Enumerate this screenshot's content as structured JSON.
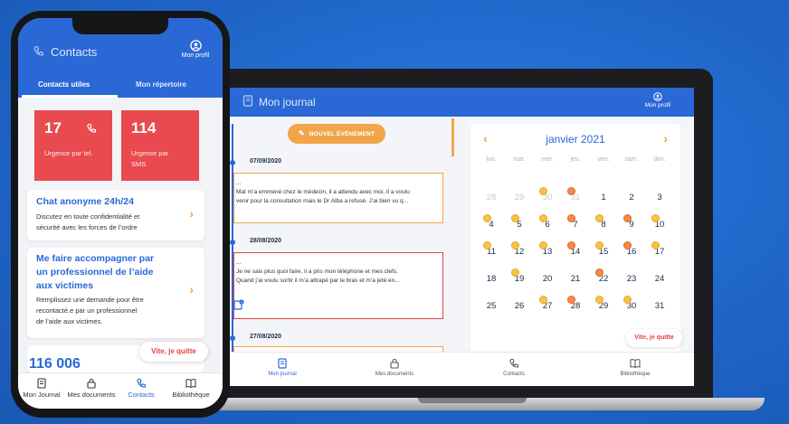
{
  "phone": {
    "header": {
      "title": "Contacts",
      "profile_label": "Mon profil"
    },
    "tabs": [
      {
        "label": "Contacts utiles",
        "active": true
      },
      {
        "label": "Mon répertoire",
        "active": false
      }
    ],
    "urgency_cards": [
      {
        "number": "17",
        "label": "Urgence par tel.",
        "icon": "phone-icon"
      },
      {
        "number": "114",
        "label_line1": "Urgence par",
        "label_line2": "SMS"
      }
    ],
    "cards": [
      {
        "title": "Chat anonyme 24h/24",
        "text_line1": "Discutez en toute confidentialité et",
        "text_line2": "sécurité avec les forces de l’ordre"
      },
      {
        "title_line1": "Me faire accompagner par",
        "title_line2": "un professionnel de l’aide",
        "title_line3": "aux victimes",
        "text_line1": "Remplissez une demande pour être",
        "text_line2": "recontacté.e par un professionnel",
        "text_line3": "de l’aide aux victimes."
      }
    ],
    "partial_number": "116 006",
    "quit_button": "Vite, je quitte",
    "nav": [
      {
        "label": "Mon Journal",
        "icon": "journal-icon",
        "active": false
      },
      {
        "label": "Mes documents",
        "icon": "lock-icon",
        "active": false
      },
      {
        "label": "Contacts",
        "icon": "phone-icon",
        "active": true
      },
      {
        "label": "Bibliothèque",
        "icon": "book-icon",
        "active": false
      }
    ]
  },
  "laptop": {
    "header": {
      "title": "Mon journal",
      "profile_label": "Mon profil"
    },
    "new_event_button": "NOUVEL ÉVÉNEMENT",
    "entries": [
      {
        "date": "07/09/2020",
        "line0": "...",
        "line1": "Mat m’a emmené chez le médecin, il a attendu avec moi. Il a voulu",
        "line2": "venir pour la consultation mais le Dr Alba a refusé. J’ai bien vu q...",
        "border": "orange"
      },
      {
        "date": "28/08/2020",
        "line0": "...",
        "line1": "Je ne sais plus quoi faire, il a pris mon téléphone et mes clefs.",
        "line2": "Quand j’ai voulu sortir il m’a attrapé par le bras et m’a jeté en...",
        "border": "red",
        "attachment_count": "1"
      },
      {
        "date": "27/08/2020"
      }
    ],
    "calendar": {
      "month": "janvier 2021",
      "weekdays": [
        "lun.",
        "mar.",
        "mer.",
        "jeu.",
        "ven.",
        "sam.",
        "dim."
      ],
      "weeks": [
        [
          "28",
          "29",
          "30",
          "31",
          "1",
          "2",
          "3"
        ],
        [
          "4",
          "5",
          "6",
          "7",
          "8",
          "9",
          "10"
        ],
        [
          "11",
          "12",
          "13",
          "14",
          "15",
          "16",
          "17"
        ],
        [
          "18",
          "19",
          "20",
          "21",
          "22",
          "23",
          "24"
        ],
        [
          "25",
          "26",
          "27",
          "28",
          "29",
          "30",
          "31"
        ]
      ],
      "muted_days_first_week": 4,
      "colors": {
        "accent": "#f1a54a",
        "primary": "#2a68d6",
        "muted": "#c3c9d4"
      }
    },
    "quit_button": "Vite, je quitte",
    "nav": [
      {
        "label": "Mon journal",
        "icon": "journal-icon",
        "active": true
      },
      {
        "label": "Mes documents",
        "icon": "lock-icon",
        "active": false
      },
      {
        "label": "Contacts",
        "icon": "phone-icon",
        "active": false
      },
      {
        "label": "Bibliothèque",
        "icon": "book-icon",
        "active": false
      }
    ]
  }
}
